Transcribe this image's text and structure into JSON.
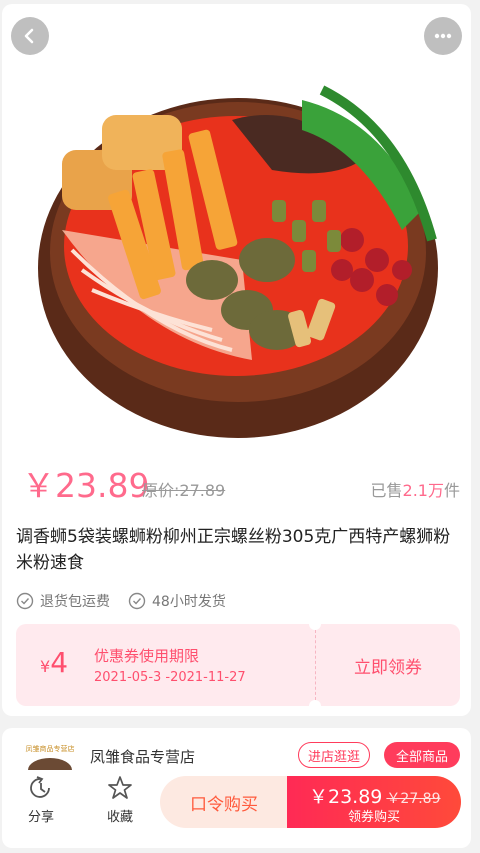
{
  "product": {
    "price": "￥23.89",
    "original_price": "原价:27.89",
    "sold_prefix": "已售",
    "sold_count": "2.1万",
    "sold_suffix": "件",
    "title": "调香蛳5袋装螺蛳粉柳州正宗螺丝粉305克广西特产螺狮粉米粉速食",
    "tags": [
      "退货包运费",
      "48小时发货"
    ]
  },
  "coupon": {
    "symbol": "¥",
    "amount": "4",
    "label": "优惠券使用期限",
    "period": "2021-05-3 -2021-11-27",
    "action": "立即领券"
  },
  "store": {
    "logo_text": "凤雏商品专营店",
    "name": "凤雏食品专营店",
    "enter_label": "进店逛逛",
    "all_label": "全部商品"
  },
  "bottom_bar": {
    "share_label": "分享",
    "favorite_label": "收藏",
    "command_buy_label": "口令购买",
    "buy_price": "￥23.89",
    "buy_old_price": "￥27.89",
    "buy_label": "领券购买"
  },
  "colors": {
    "accent": "#ff6a8c",
    "buy_red": "#ff2a55",
    "coupon_bg": "#ffeaee"
  },
  "icons": {
    "back": "back-arrow-icon",
    "more": "more-dots-icon",
    "check": "check-circle-icon",
    "share": "share-icon",
    "favorite": "star-icon"
  }
}
